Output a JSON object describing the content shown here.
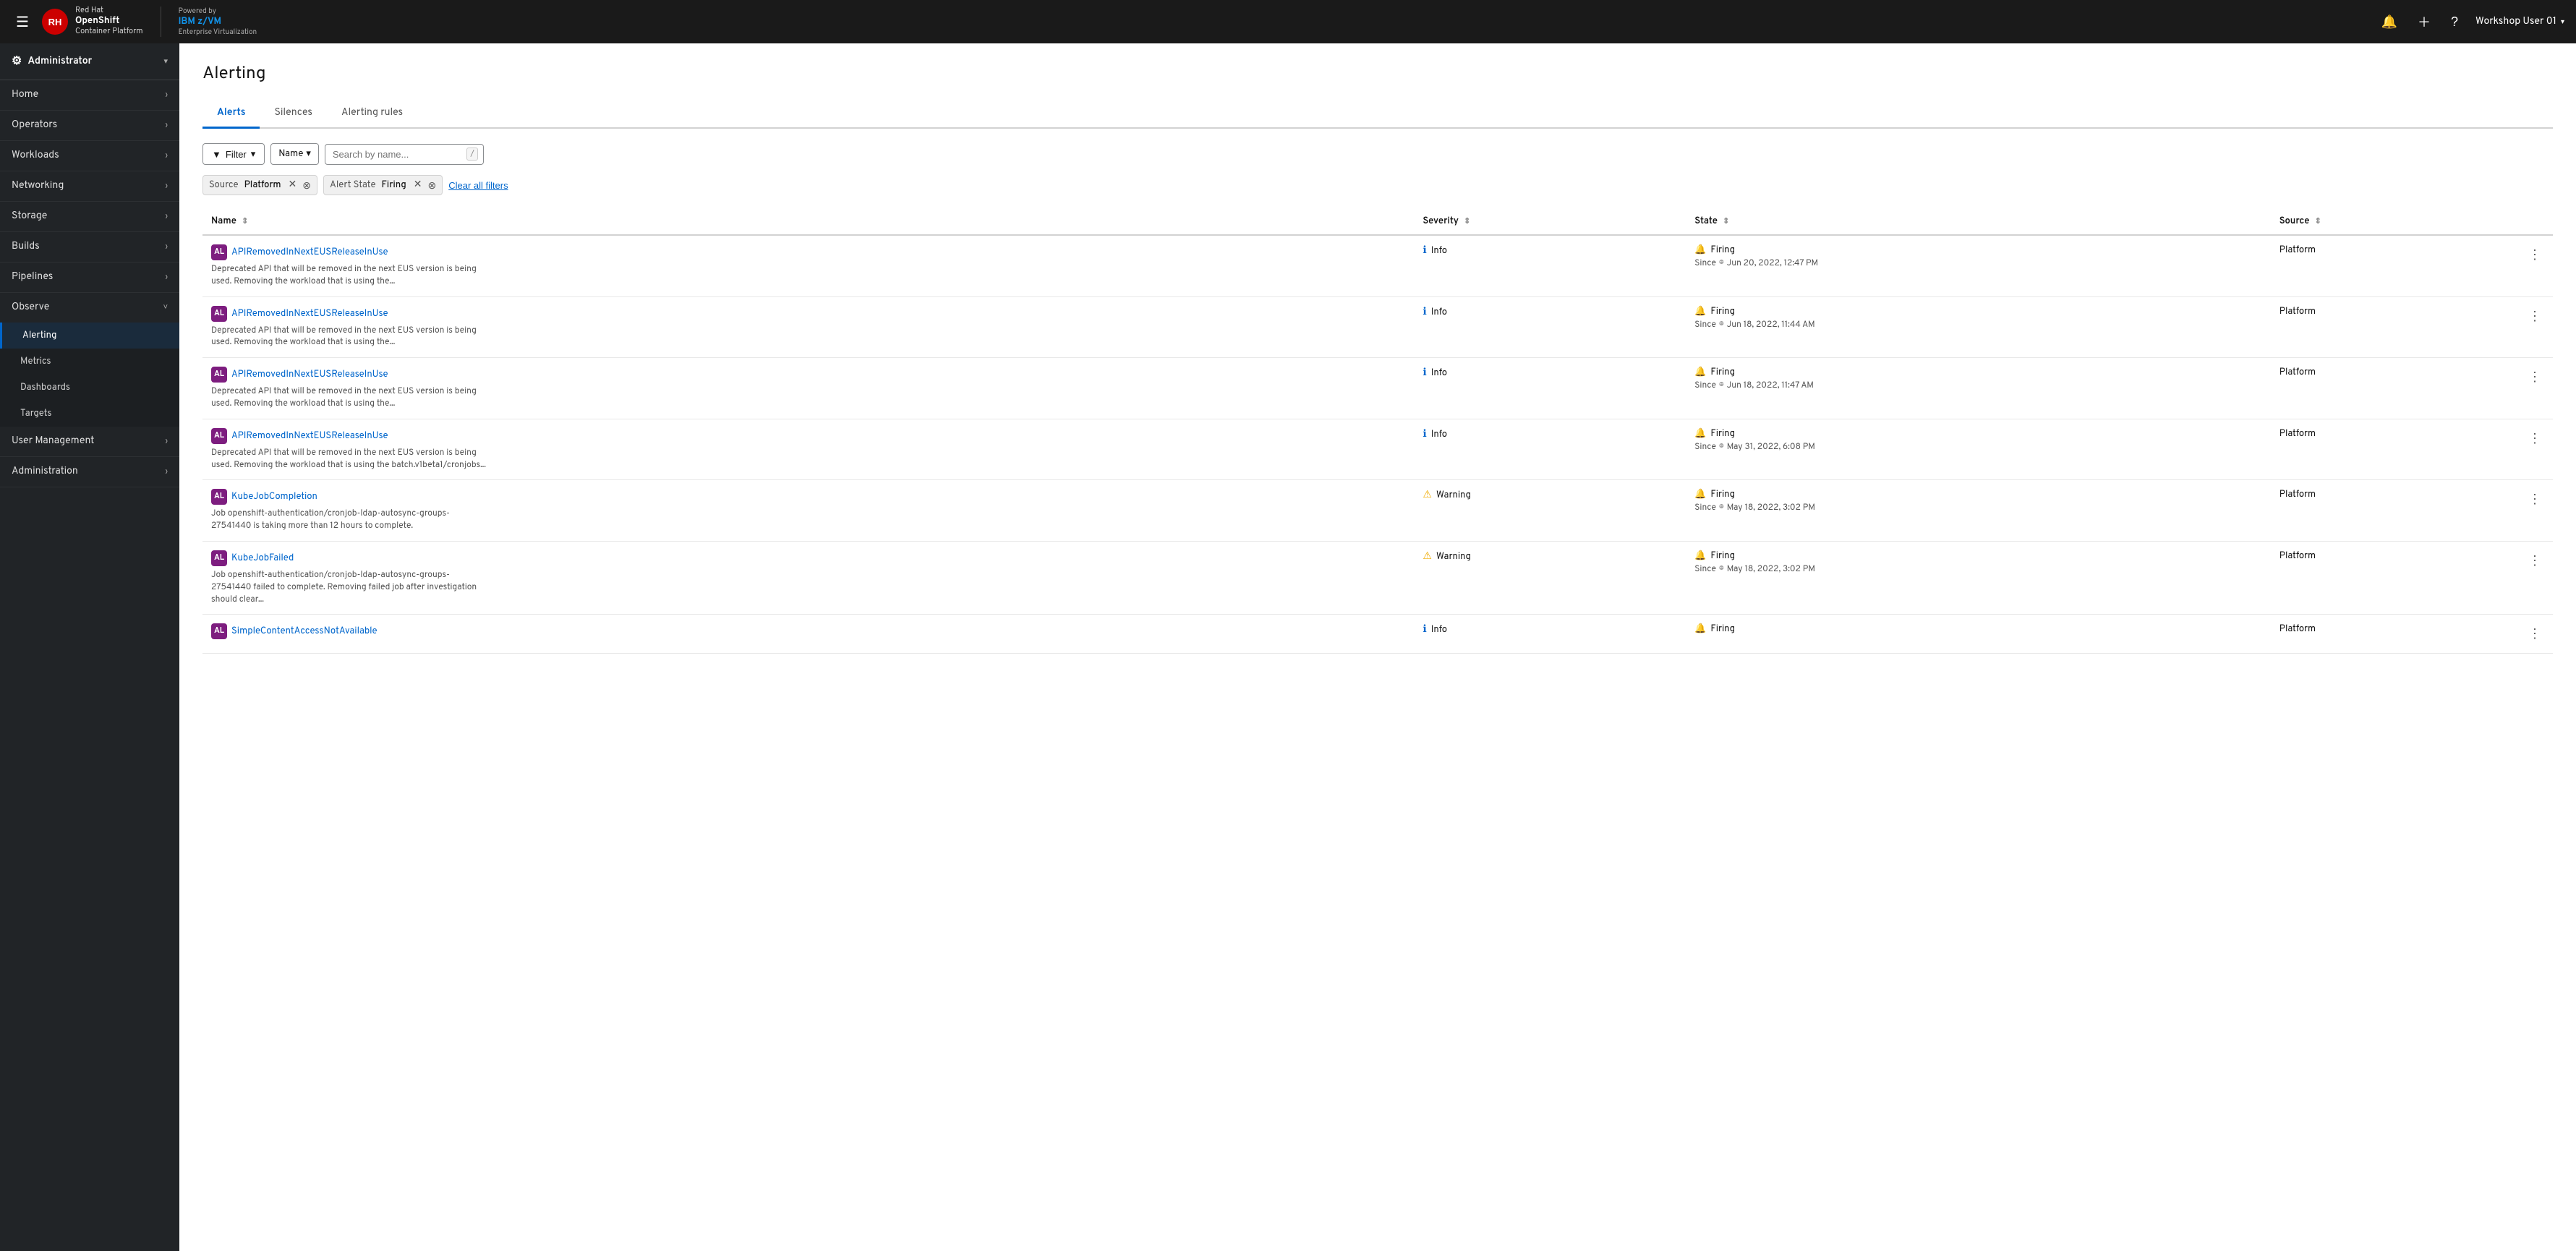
{
  "topnav": {
    "menu_label": "Menu",
    "brand": {
      "redhat": "Red Hat",
      "openshift": "OpenShift",
      "container_platform": "Container Platform"
    },
    "powered_by": {
      "label": "Powered by",
      "brand_ibm": "IBM",
      "brand_zvm": "z/VM",
      "subtitle": "Enterprise Virtualization"
    },
    "icons": {
      "bell": "🔔",
      "plus": "＋",
      "help": "?"
    },
    "user": "Workshop User 01",
    "caret": "▾"
  },
  "sidebar": {
    "role": "Administrator",
    "role_icon": "⚙",
    "items": [
      {
        "id": "home",
        "label": "Home",
        "has_children": true
      },
      {
        "id": "operators",
        "label": "Operators",
        "has_children": true
      },
      {
        "id": "workloads",
        "label": "Workloads",
        "has_children": true
      },
      {
        "id": "networking",
        "label": "Networking",
        "has_children": true
      },
      {
        "id": "storage",
        "label": "Storage",
        "has_children": true
      },
      {
        "id": "builds",
        "label": "Builds",
        "has_children": true
      },
      {
        "id": "pipelines",
        "label": "Pipelines",
        "has_children": true
      },
      {
        "id": "observe",
        "label": "Observe",
        "has_children": true,
        "expanded": true
      },
      {
        "id": "user-management",
        "label": "User Management",
        "has_children": true
      },
      {
        "id": "administration",
        "label": "Administration",
        "has_children": true
      }
    ],
    "observe_sub_items": [
      {
        "id": "alerting",
        "label": "Alerting",
        "active": true
      },
      {
        "id": "metrics",
        "label": "Metrics"
      },
      {
        "id": "dashboards",
        "label": "Dashboards"
      },
      {
        "id": "targets",
        "label": "Targets"
      }
    ]
  },
  "page": {
    "title": "Alerting",
    "tabs": [
      {
        "id": "alerts",
        "label": "Alerts",
        "active": true
      },
      {
        "id": "silences",
        "label": "Silences"
      },
      {
        "id": "alerting-rules",
        "label": "Alerting rules"
      }
    ]
  },
  "filter_bar": {
    "filter_label": "Filter",
    "filter_icon": "▼",
    "name_label": "Name",
    "name_caret": "▼",
    "search_placeholder": "Search by name...",
    "slash_hint": "/"
  },
  "filter_tags": [
    {
      "key": "Source",
      "value": "Platform"
    },
    {
      "key": "Alert State",
      "value": "Firing"
    }
  ],
  "clear_all_label": "Clear all filters",
  "table": {
    "columns": [
      {
        "id": "name",
        "label": "Name"
      },
      {
        "id": "severity",
        "label": "Severity"
      },
      {
        "id": "state",
        "label": "State"
      },
      {
        "id": "source",
        "label": "Source"
      }
    ],
    "rows": [
      {
        "id": "row1",
        "badge": "AL",
        "name": "APIRemovedInNextEUSReleaseInUse",
        "description": "Deprecated API that will be removed in the next EUS version is being used. Removing the workload that is using the...",
        "severity_icon": "info",
        "severity": "Info",
        "state": "Firing",
        "state_since": "Jun 20, 2022, 12:47 PM",
        "source": "Platform"
      },
      {
        "id": "row2",
        "badge": "AL",
        "name": "APIRemovedInNextEUSReleaseInUse",
        "description": "Deprecated API that will be removed in the next EUS version is being used. Removing the workload that is using the...",
        "severity_icon": "info",
        "severity": "Info",
        "state": "Firing",
        "state_since": "Jun 18, 2022, 11:44 AM",
        "source": "Platform"
      },
      {
        "id": "row3",
        "badge": "AL",
        "name": "APIRemovedInNextEUSReleaseInUse",
        "description": "Deprecated API that will be removed in the next EUS version is being used. Removing the workload that is using the...",
        "severity_icon": "info",
        "severity": "Info",
        "state": "Firing",
        "state_since": "Jun 18, 2022, 11:47 AM",
        "source": "Platform"
      },
      {
        "id": "row4",
        "badge": "AL",
        "name": "APIRemovedInNextEUSReleaseInUse",
        "description": "Deprecated API that will be removed in the next EUS version is being used. Removing the workload that is using the batch.v1beta1/cronjobs...",
        "severity_icon": "info",
        "severity": "Info",
        "state": "Firing",
        "state_since": "May 31, 2022, 6:08 PM",
        "source": "Platform"
      },
      {
        "id": "row5",
        "badge": "AL",
        "name": "KubeJobCompletion",
        "description": "Job openshift-authentication/cronjob-ldap-autosync-groups-27541440 is taking more than 12 hours to complete.",
        "severity_icon": "warning",
        "severity": "Warning",
        "state": "Firing",
        "state_since": "May 18, 2022, 3:02 PM",
        "source": "Platform"
      },
      {
        "id": "row6",
        "badge": "AL",
        "name": "KubeJobFailed",
        "description": "Job openshift-authentication/cronjob-ldap-autosync-groups-27541440 failed to complete. Removing failed job after investigation should clear...",
        "severity_icon": "warning",
        "severity": "Warning",
        "state": "Firing",
        "state_since": "May 18, 2022, 3:02 PM",
        "source": "Platform"
      },
      {
        "id": "row7",
        "badge": "AL",
        "name": "SimpleContentAccessNotAvailable",
        "description": "",
        "severity_icon": "info",
        "severity": "Info",
        "state": "Firing",
        "state_since": "",
        "source": "Platform"
      }
    ]
  }
}
